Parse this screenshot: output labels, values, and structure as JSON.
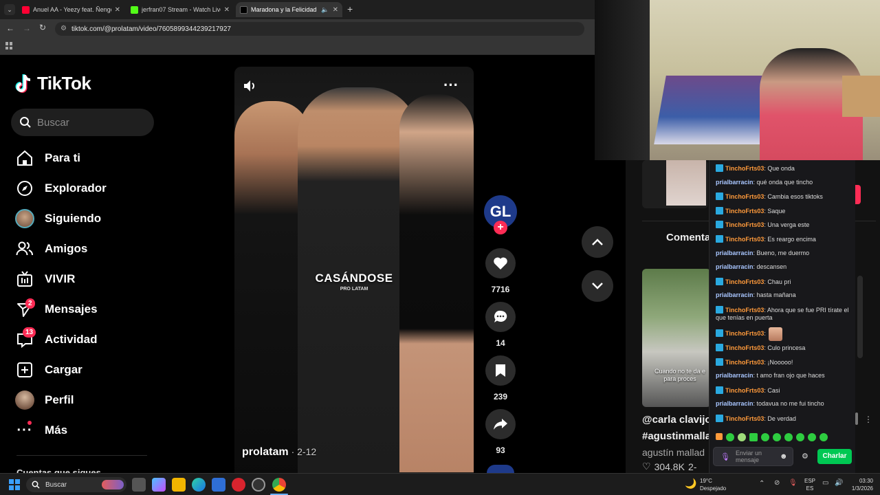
{
  "browser": {
    "tabs": [
      {
        "title": "Anuel AA - Yeezy feat. Ñengo F",
        "favicon_color": "#ff0033"
      },
      {
        "title": "jerfran07 Stream - Watch Live o",
        "favicon_color": "#53fc18"
      },
      {
        "title": "Maradona y la Felicidad de",
        "favicon_color": "#000000"
      }
    ],
    "url": "tiktok.com/@prolatam/video/7605899344239217927"
  },
  "tiktok": {
    "logo_text": "TikTok",
    "search_placeholder": "Buscar",
    "nav": [
      {
        "label": "Para ti",
        "icon": "home-icon"
      },
      {
        "label": "Explorador",
        "icon": "compass-icon"
      },
      {
        "label": "Siguiendo",
        "icon": "avatar-icon"
      },
      {
        "label": "Amigos",
        "icon": "friends-icon"
      },
      {
        "label": "VIVIR",
        "icon": "live-icon"
      },
      {
        "label": "Mensajes",
        "icon": "send-icon",
        "badge": "2"
      },
      {
        "label": "Actividad",
        "icon": "inbox-icon",
        "badge": "13"
      },
      {
        "label": "Cargar",
        "icon": "plus-square-icon"
      },
      {
        "label": "Perfil",
        "icon": "profile-avatar-icon"
      },
      {
        "label": "Más",
        "icon": "more-icon"
      }
    ],
    "following_heading": "Cuentas que sigues",
    "video": {
      "overlay_text": "CASÁNDOSE",
      "watermark": "PRO LATAM",
      "author": "prolatam",
      "date": "· 2-12",
      "likes": "7716",
      "comments": "14",
      "saves": "239",
      "shares": "93",
      "avatar_text": "GL"
    },
    "right_panel": {
      "comments_tab": "Comenta",
      "card_caption": "Cuando no te da e\npara proces",
      "suggested_user": "@carla clavijo",
      "suggested_tag": "#agustinmalla",
      "suggested_author": "agustín mallad",
      "suggested_likes": "304.8K",
      "suggested_extra": "2-"
    }
  },
  "chat": {
    "messages": [
      {
        "user": "TinchoFrts03",
        "text": "Que onda",
        "badge": true
      },
      {
        "user": "prialbarracin",
        "text": "qué onda que tincho",
        "badge": false
      },
      {
        "user": "TinchoFrts03",
        "text": "Cambia esos tiktoks",
        "badge": true
      },
      {
        "user": "TinchoFrts03",
        "text": "Saque",
        "badge": true
      },
      {
        "user": "TinchoFrts03",
        "text": "Una verga este",
        "badge": true
      },
      {
        "user": "TinchoFrts03",
        "text": "Es reargo encima",
        "badge": true
      },
      {
        "user": "prialbarracin",
        "text": "Bueno, me duermo",
        "badge": false
      },
      {
        "user": "prialbarracin",
        "text": "descansen",
        "badge": false
      },
      {
        "user": "TinchoFrts03",
        "text": "Chau pri",
        "badge": true
      },
      {
        "user": "prialbarracin",
        "text": "hasta mañana",
        "badge": false
      },
      {
        "user": "TinchoFrts03",
        "text": "Ahora que se fue PRI tírate el que tenías en puerta",
        "badge": true
      },
      {
        "user": "TinchoFrts03",
        "text": "",
        "badge": true
      },
      {
        "user": "TinchoFrts03",
        "text": "Culo princesa",
        "badge": true
      },
      {
        "user": "TinchoFrts03",
        "text": "¡Nooooo!",
        "badge": true
      },
      {
        "user": "prialbarracin",
        "text": "t amo fran ojo que haces",
        "badge": false
      },
      {
        "user": "TinchoFrts03",
        "text": "Casi",
        "badge": true
      },
      {
        "user": "prialbarracin",
        "text": "todavua no me fui tincho",
        "badge": false
      },
      {
        "user": "TinchoFrts03",
        "text": "De verdad",
        "badge": true
      }
    ],
    "input_placeholder": "Enviar un mensaje",
    "send_label": "Charlar"
  },
  "taskbar": {
    "search_label": "Buscar",
    "weather_temp": "19°C",
    "weather_desc": "Despejado",
    "lang_top": "ESP",
    "lang_bottom": "ES",
    "time": "03:30",
    "date": "1/3/2026"
  },
  "colors": {
    "accent": "#fe2c55",
    "chat_send": "#00c853"
  }
}
